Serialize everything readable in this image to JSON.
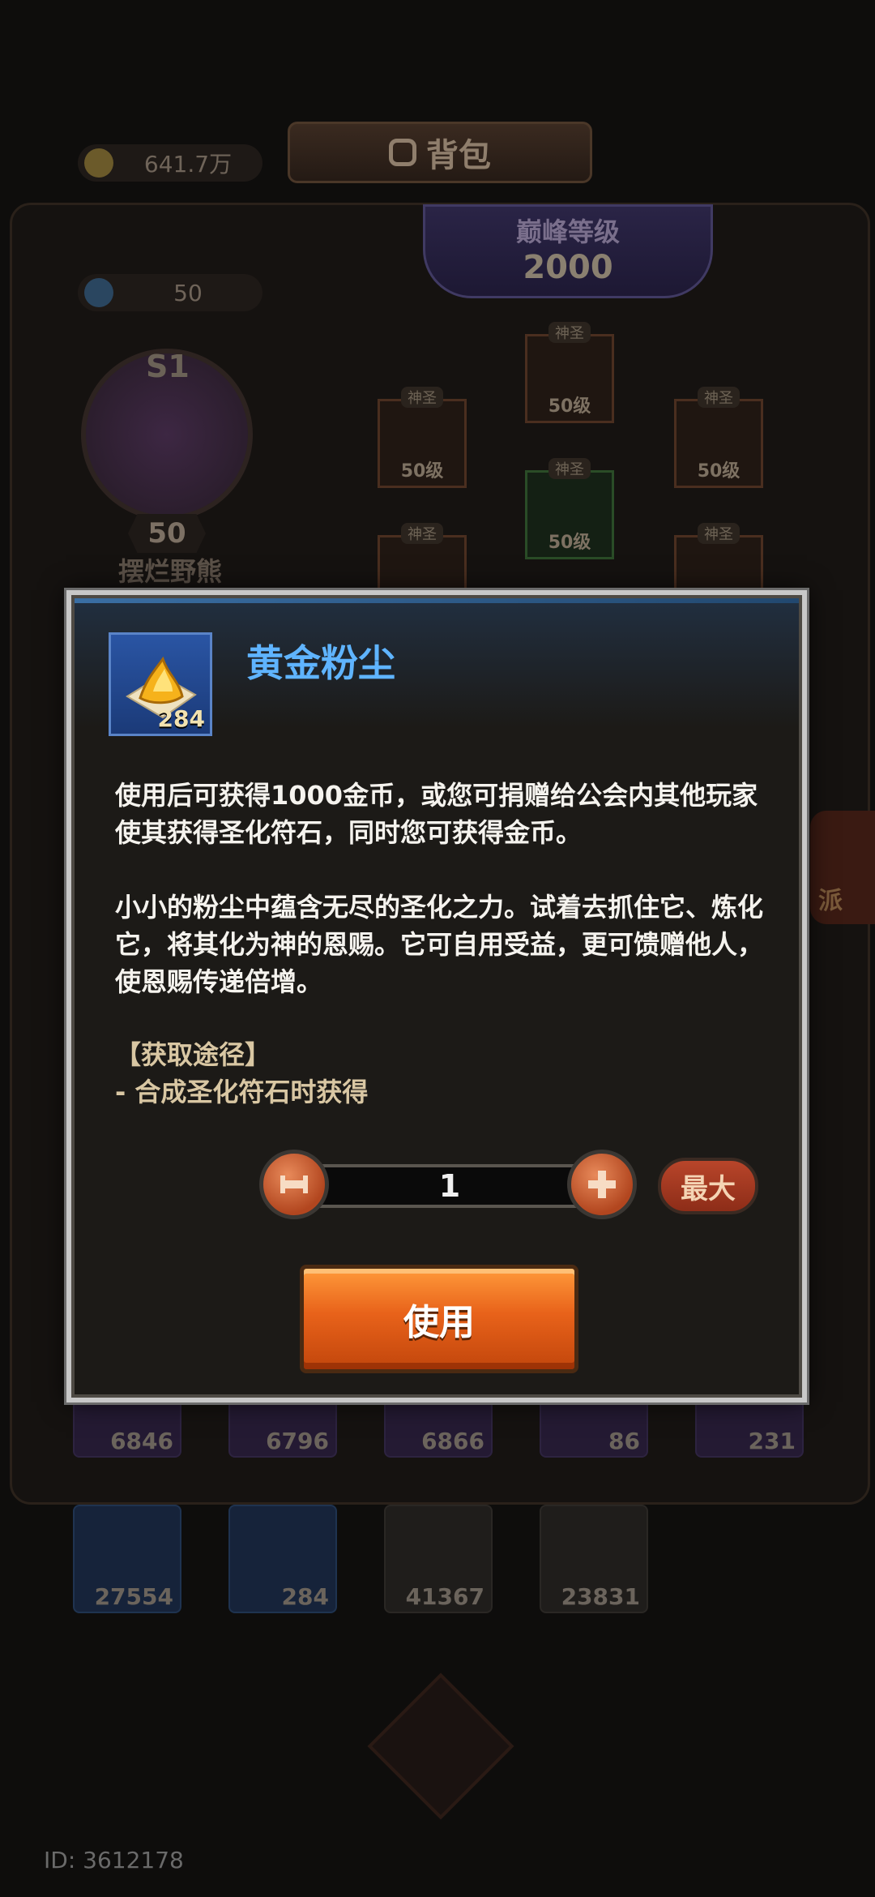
{
  "background": {
    "title": "背包",
    "gold": "641.7万",
    "gems": "50",
    "peak_label": "巅峰等级",
    "peak_level": "2000",
    "season": "S1",
    "player_level": "50",
    "player_name": "摆烂野熊",
    "faction_label": "派",
    "equipment": [
      {
        "badge": "神圣",
        "level": "50级"
      },
      {
        "badge": "神圣",
        "level": "50级"
      },
      {
        "badge": "神圣",
        "level": "50级"
      },
      {
        "badge": "神圣",
        "level": "50级"
      },
      {
        "badge": "神圣",
        "level": ""
      },
      {
        "badge": "神圣",
        "level": ""
      }
    ],
    "inventory_row1": [
      "6846",
      "6796",
      "6866",
      "86",
      "231"
    ],
    "inventory_row2": [
      "27554",
      "284",
      "41367",
      "23831"
    ],
    "user_id": "ID: 3612178"
  },
  "modal": {
    "item_name": "黄金粉尘",
    "item_count": "284",
    "description": [
      "使用后可获得1000金币，或您可捐赠给公会内其他玩家使其获得圣化符石，同时您可获得金币。",
      "小小的粉尘中蕴含无尽的圣化之力。试着去抓住它、炼化它，将其化为神的恩赐。它可自用受益，更可馈赠他人，使恩赐传递倍增。"
    ],
    "source_title": "【获取途径】",
    "source_line": "- 合成圣化符石时获得",
    "quantity": "1",
    "max_label": "最大",
    "use_label": "使用"
  },
  "colors": {
    "item_name": "#5fb4ff",
    "use_button": "#e8621a",
    "max_button": "#b8452a"
  }
}
